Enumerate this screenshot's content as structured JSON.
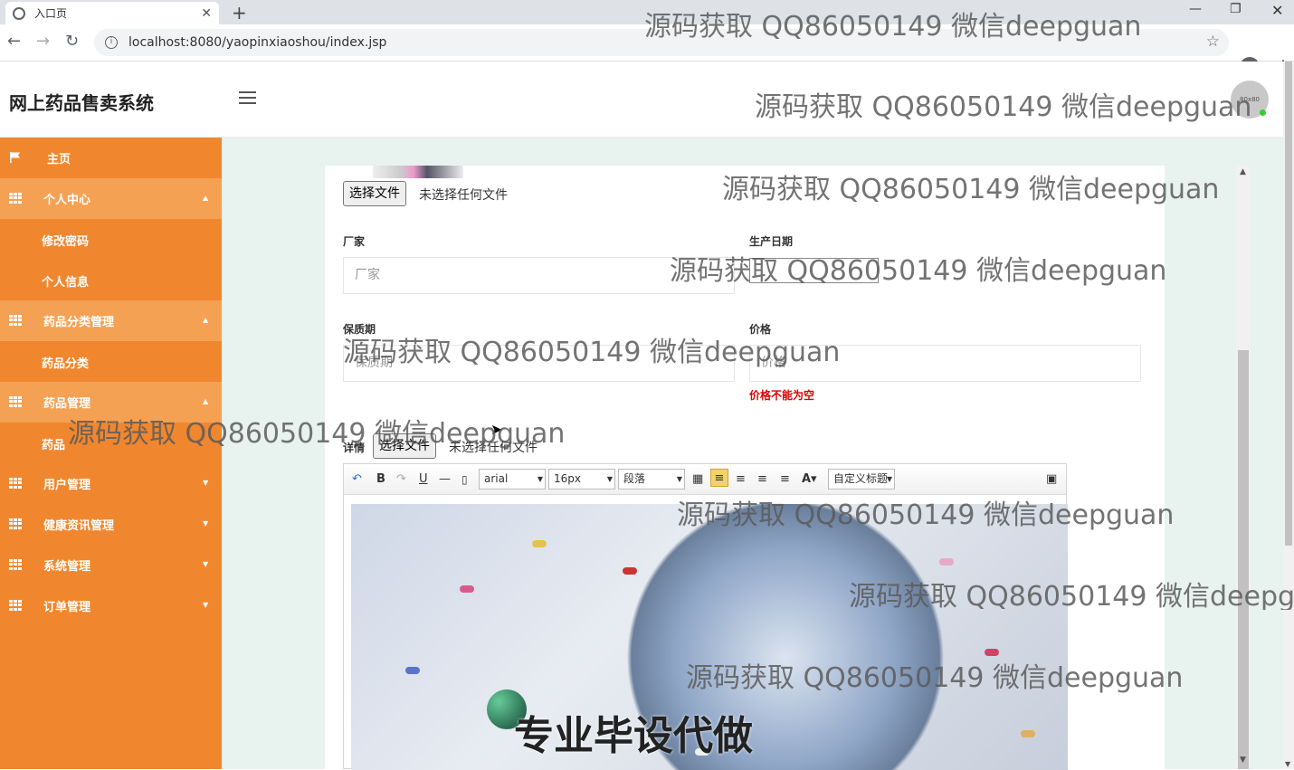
{
  "browser": {
    "tab_title": "入口页",
    "url": "localhost:8080/yaopinxiaoshou/index.jsp"
  },
  "app": {
    "brand": "网上药品售卖系统",
    "avatar_text": "80x80"
  },
  "sidebar": {
    "items": [
      {
        "label": "主页",
        "icon": "flag-icon",
        "state": "plain"
      },
      {
        "label": "个人中心",
        "icon": "grid-icon",
        "state": "open"
      },
      {
        "label": "修改密码",
        "sub": true
      },
      {
        "label": "个人信息",
        "sub": true
      },
      {
        "label": "药品分类管理",
        "icon": "grid-icon",
        "state": "open"
      },
      {
        "label": "药品分类",
        "sub": true
      },
      {
        "label": "药品管理",
        "icon": "grid-icon",
        "state": "open"
      },
      {
        "label": "药品",
        "sub": true
      },
      {
        "label": "用户管理",
        "icon": "grid-icon",
        "state": "closed"
      },
      {
        "label": "健康资讯管理",
        "icon": "grid-icon",
        "state": "closed"
      },
      {
        "label": "系统管理",
        "icon": "grid-icon",
        "state": "closed"
      },
      {
        "label": "订单管理",
        "icon": "grid-icon",
        "state": "closed"
      }
    ]
  },
  "form": {
    "file_button": "选择文件",
    "no_file": "未选择任何文件",
    "manufacturer_label": "厂家",
    "manufacturer_placeholder": "厂家",
    "production_date_label": "生产日期",
    "shelf_life_label": "保质期",
    "shelf_life_placeholder": "保质期",
    "price_label": "价格",
    "price_placeholder": "价格",
    "price_error": "价格不能为空",
    "details_label": "详情"
  },
  "editor": {
    "font": "arial",
    "size": "16px",
    "paragraph": "段落",
    "custom_title": "自定义标题",
    "image_caption": "专业毕设代做"
  },
  "watermark": "源码获取 QQ86050149 微信deepguan",
  "colors": {
    "sidebar": "#f0872e",
    "sidebar_open": "#f5a154",
    "error": "#dd0000"
  }
}
